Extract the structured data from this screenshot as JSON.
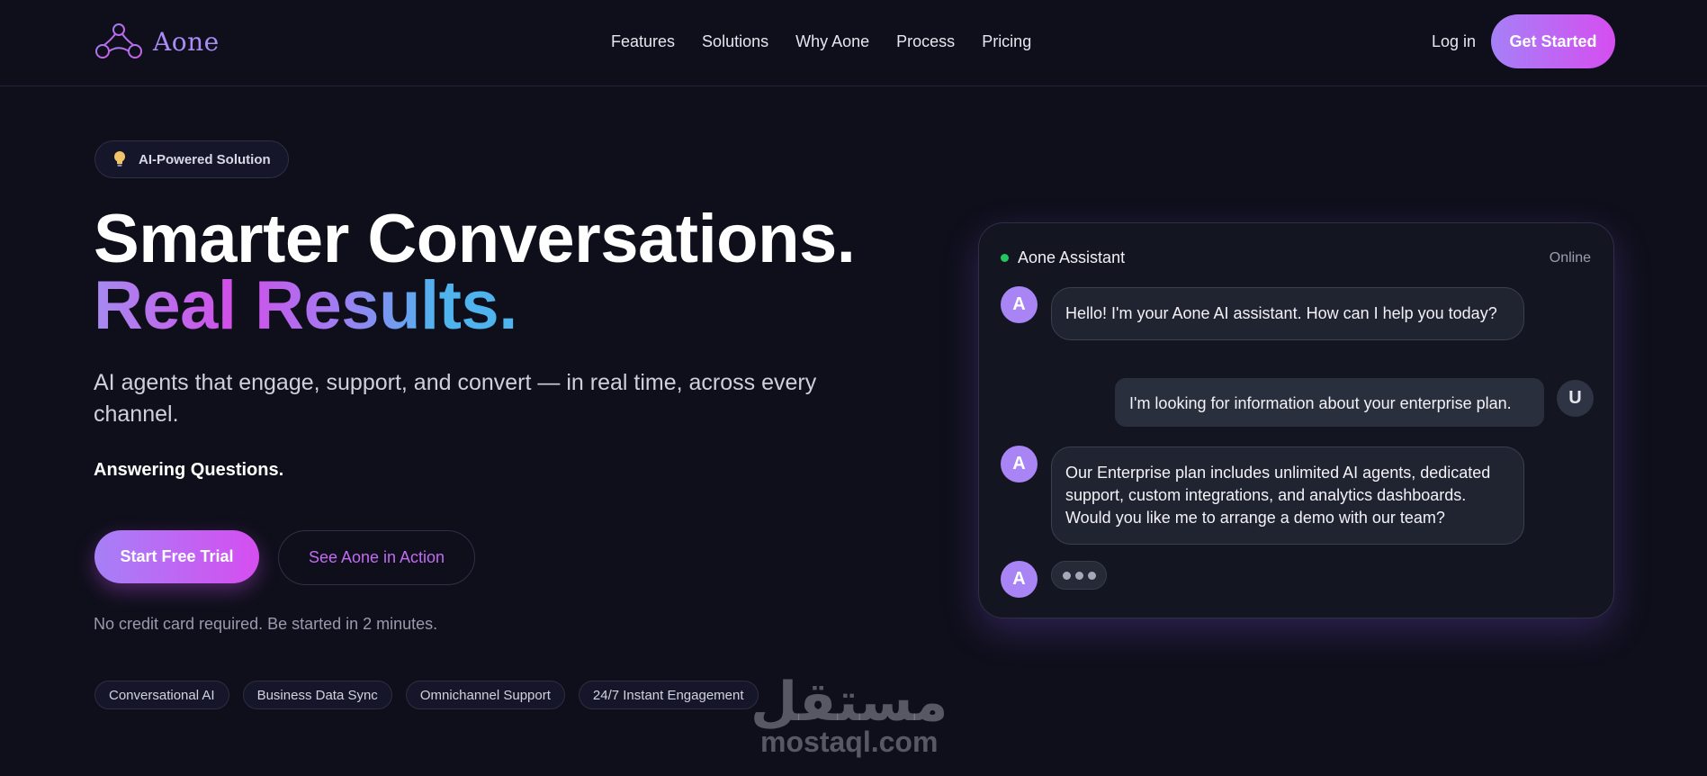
{
  "brand": {
    "name": "Aone"
  },
  "nav": {
    "links": [
      "Features",
      "Solutions",
      "Why Aone",
      "Process",
      "Pricing"
    ],
    "login": "Log in",
    "cta": "Get Started"
  },
  "hero": {
    "badge": "AI-Powered Solution",
    "title_line1": "Smarter Conversations.",
    "title_line2": "Real Results",
    "title_line2_dot": ".",
    "subtitle": "AI agents that engage, support, and convert — in real time, across every channel.",
    "typed_text": "Answering Questions.",
    "primary_cta": "Start Free Trial",
    "secondary_cta": "See Aone in Action",
    "note": "No credit card required. Be started in 2 minutes.",
    "tags": [
      "Conversational AI",
      "Business Data Sync",
      "Omnichannel Support",
      "24/7 Instant Engagement"
    ]
  },
  "chat": {
    "title": "Aone Assistant",
    "status": "Online",
    "assistant_initial": "A",
    "user_initial": "U",
    "messages": [
      {
        "from": "assistant",
        "text": "Hello! I'm your Aone AI assistant. How can I help you today?"
      },
      {
        "from": "user",
        "text": "I'm looking for information about your enterprise plan."
      },
      {
        "from": "assistant",
        "text": "Our Enterprise plan includes unlimited AI agents, dedicated support, custom integrations, and analytics dashboards. Would you like me to arrange a demo with our team?"
      }
    ]
  },
  "watermark": {
    "arabic": "مستقل",
    "latin": "mostaql.com"
  },
  "colors": {
    "background": "#0f0f1b",
    "accent_start": "#a680f7",
    "accent_end": "#d54ef0",
    "online": "#22c55e",
    "highlight_blue": "#4fb3ee"
  },
  "icons": {
    "logo": "aone-logo-icon",
    "badge": "lightbulb-icon",
    "online": "online-dot-icon",
    "typing": "typing-dots-icon"
  }
}
